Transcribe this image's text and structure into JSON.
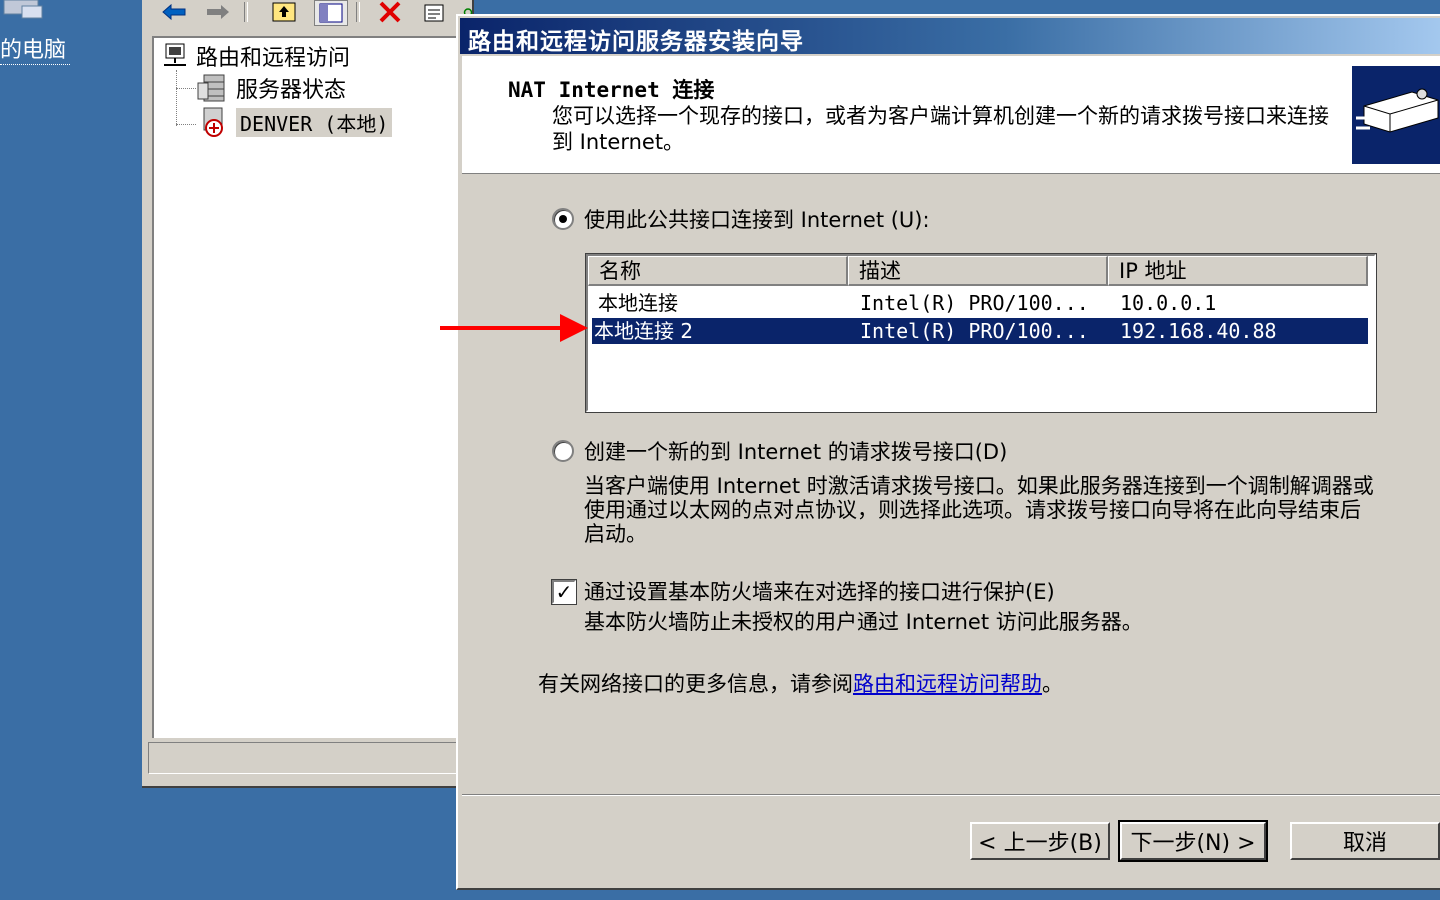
{
  "desktop": {
    "icon_label": "的电脑"
  },
  "mmc": {
    "tree": {
      "root": "路由和远程访问",
      "server_status": "服务器状态",
      "server_node": "DENVER (本地)"
    }
  },
  "wizard": {
    "title": "路由和远程访问服务器安装向导",
    "header_title": "NAT Internet 连接",
    "header_desc": "您可以选择一个现存的接口，或者为客户端计算机创建一个新的请求拨号接口来连接到 Internet。",
    "option_existing": "使用此公共接口连接到 Internet (U):",
    "option_existing_selected": true,
    "interfaces": {
      "columns": [
        "名称",
        "描述",
        "IP 地址"
      ],
      "rows": [
        {
          "name": "本地连接",
          "description": "Intel(R) PRO/100...",
          "ip": "10.0.0.1",
          "selected": false
        },
        {
          "name": "本地连接 2",
          "description": "Intel(R) PRO/100...",
          "ip": "192.168.40.88",
          "selected": true
        }
      ]
    },
    "option_new": "创建一个新的到 Internet 的请求拨号接口(D)",
    "option_new_desc": "当客户端使用 Internet 时激活请求拨号接口。如果此服务器连接到一个调制解调器或使用通过以太网的点对点协议，则选择此选项。请求拨号接口向导将在此向导结束后启动。",
    "firewall_label": "通过设置基本防火墙来在对选择的接口进行保护(E)",
    "firewall_checked": true,
    "firewall_desc": "基本防火墙防止未授权的用户通过 Internet 访问此服务器。",
    "help_prefix": "有关网络接口的更多信息，请参阅",
    "help_link": "路由和远程访问帮助",
    "help_suffix": "。",
    "buttons": {
      "back": "< 上一步(B)",
      "next": "下一步(N) >",
      "cancel": "取消"
    }
  },
  "colors": {
    "desktop": "#3a6ea5",
    "title_start": "#0a246a",
    "selection": "#0a246a",
    "annotation_arrow": "#ff0000",
    "link": "#0000cc"
  },
  "icons": [
    "computer-icon",
    "back-arrow-icon",
    "forward-arrow-icon",
    "up-folder-icon",
    "show-hide-tree-icon",
    "delete-icon",
    "properties-icon",
    "refresh-icon",
    "export-icon",
    "help-icon",
    "routing-server-icon",
    "server-status-icon",
    "server-node-icon",
    "wizard-header-icon",
    "red-annotation-arrow"
  ]
}
